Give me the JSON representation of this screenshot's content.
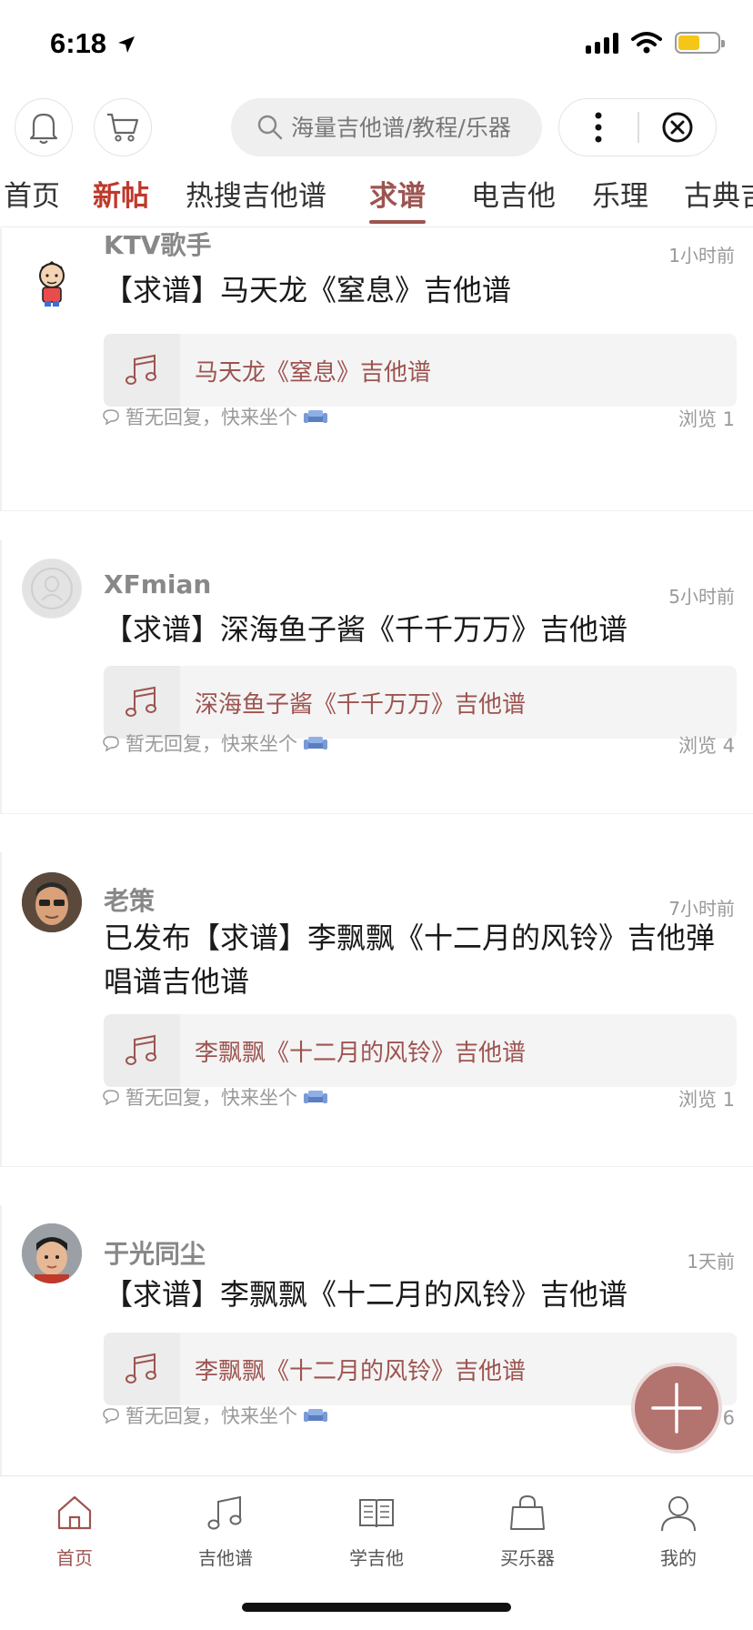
{
  "status_bar": {
    "time": "6:18"
  },
  "toolbar": {
    "search_placeholder": "海量吉他谱/教程/乐器"
  },
  "tabs": [
    {
      "label": "首页"
    },
    {
      "label": "新帖"
    },
    {
      "label": "热搜吉他谱"
    },
    {
      "label": "求谱"
    },
    {
      "label": "电吉他"
    },
    {
      "label": "乐理"
    },
    {
      "label": "古典吉"
    }
  ],
  "posts": [
    {
      "username": "KTV歌手",
      "time": "1小时前",
      "title": "【求谱】马天龙《窒息》吉他谱",
      "card": "马天龙《窒息》吉他谱",
      "reply": "暂无回复，快来坐个",
      "views": "浏览 1"
    },
    {
      "username": "XFmian",
      "time": "5小时前",
      "title": "【求谱】深海鱼子酱《千千万万》吉他谱",
      "card": "深海鱼子酱《千千万万》吉他谱",
      "reply": "暂无回复，快来坐个",
      "views": "浏览 4"
    },
    {
      "username": "老策",
      "time": "7小时前",
      "title": "已发布【求谱】李飘飘《十二月的风铃》吉他弹唱谱吉他谱",
      "card": "李飘飘《十二月的风铃》吉他谱",
      "reply": "暂无回复，快来坐个",
      "views": "浏览 1"
    },
    {
      "username": "于光同尘",
      "time": "1天前",
      "title": "【求谱】李飘飘《十二月的风铃》吉他谱",
      "card": "李飘飘《十二月的风铃》吉他谱",
      "reply": "暂无回复，快来坐个",
      "views": "浏览 6"
    }
  ],
  "bottom_nav": [
    {
      "label": "首页",
      "icon": "home-icon"
    },
    {
      "label": "吉他谱",
      "icon": "music-note-icon"
    },
    {
      "label": "学吉他",
      "icon": "book-icon"
    },
    {
      "label": "买乐器",
      "icon": "shopping-bag-icon"
    },
    {
      "label": "我的",
      "icon": "user-icon"
    }
  ],
  "colors": {
    "accent": "#9d5450",
    "new_tab": "#c0392b",
    "fab": "#b3736f"
  }
}
